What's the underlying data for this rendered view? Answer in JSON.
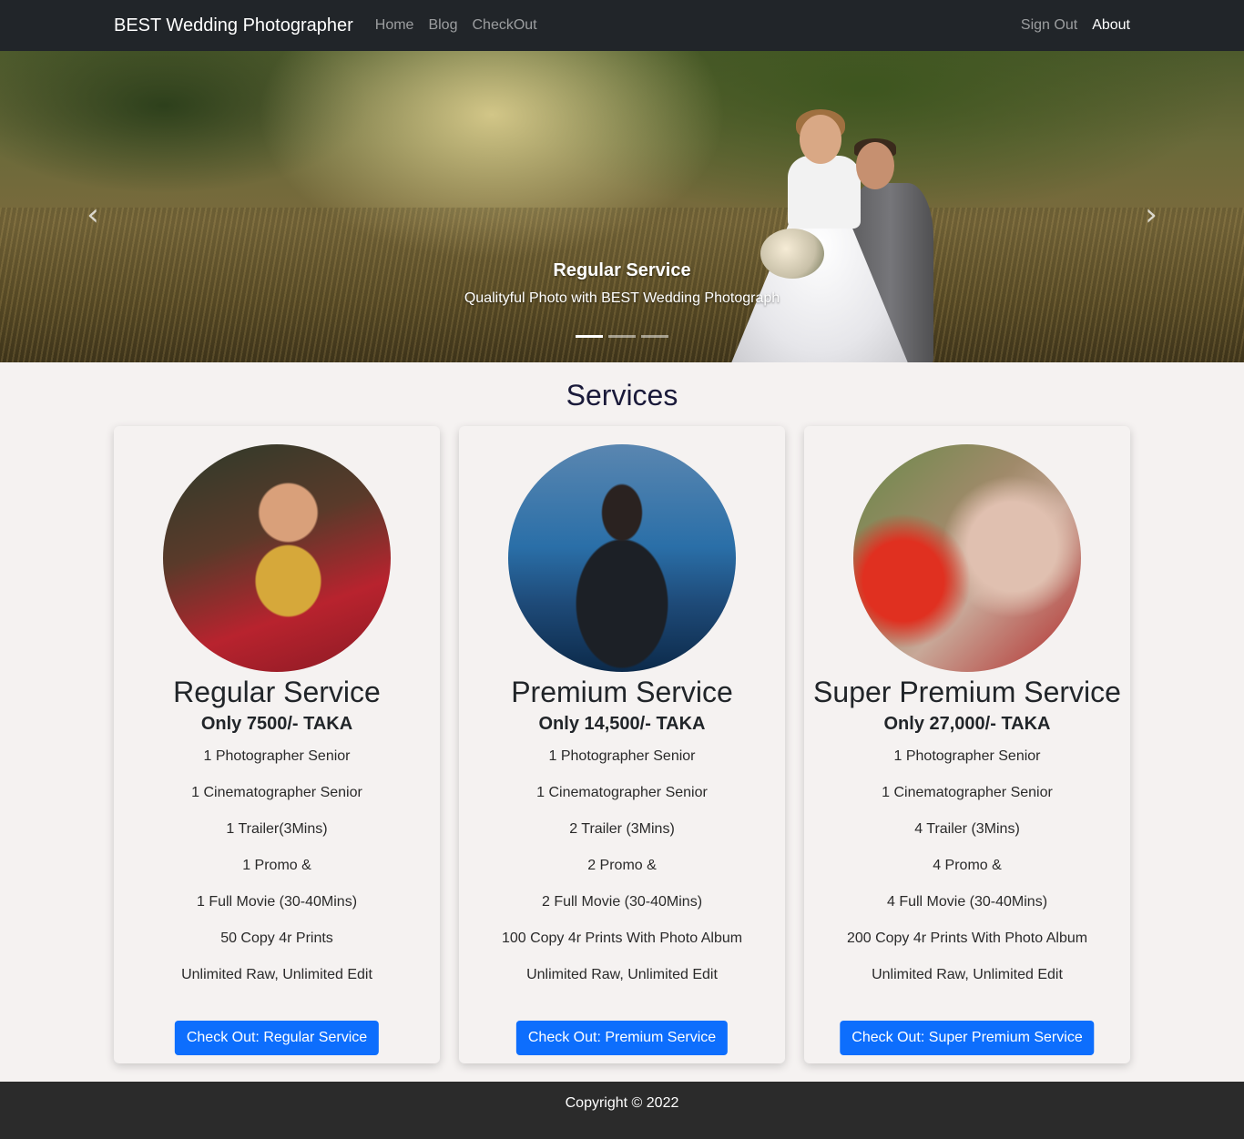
{
  "nav": {
    "brand": "BEST Wedding Photographer",
    "links": [
      "Home",
      "Blog",
      "CheckOut"
    ],
    "right_links": [
      "Sign Out",
      "About"
    ]
  },
  "hero": {
    "caption_title": "Regular Service",
    "caption_text": "Qualityful Photo with BEST Wedding Photograph",
    "prev_icon": "‹",
    "next_icon": "›",
    "slide_count": 3,
    "active_slide": 1
  },
  "services": {
    "title": "Services",
    "cards": [
      {
        "name": "Regular Service",
        "price": "Only 7500/- TAKA",
        "features": [
          "1 Photographer Senior",
          "1 Cinematographer Senior",
          "1 Trailer(3Mins)",
          "1 Promo &",
          "1 Full Movie (30-40Mins)",
          "50 Copy 4r Prints",
          "Unlimited Raw, Unlimited Edit"
        ],
        "button": "Check Out: Regular Service"
      },
      {
        "name": "Premium Service",
        "price": "Only 14,500/- TAKA",
        "features": [
          "1 Photographer Senior",
          "1 Cinematographer Senior",
          "2 Trailer (3Mins)",
          "2 Promo &",
          "2 Full Movie (30-40Mins)",
          "100 Copy 4r Prints With Photo Album",
          "Unlimited Raw, Unlimited Edit"
        ],
        "button": "Check Out: Premium Service"
      },
      {
        "name": "Super Premium Service",
        "price": "Only 27,000/- TAKA",
        "features": [
          "1 Photographer Senior",
          "1 Cinematographer Senior",
          "4 Trailer (3Mins)",
          "4 Promo &",
          "4 Full Movie (30-40Mins)",
          "200 Copy 4r Prints With Photo Album",
          "Unlimited Raw, Unlimited Edit"
        ],
        "button": "Check Out: Super Premium Service"
      }
    ]
  },
  "footer": {
    "copyright": "Copyright © 2022"
  },
  "colors": {
    "navbar": "#212529",
    "primary_button": "#0d6efd",
    "footer": "#2b2b2b",
    "page_bg": "#f5f2f1"
  }
}
